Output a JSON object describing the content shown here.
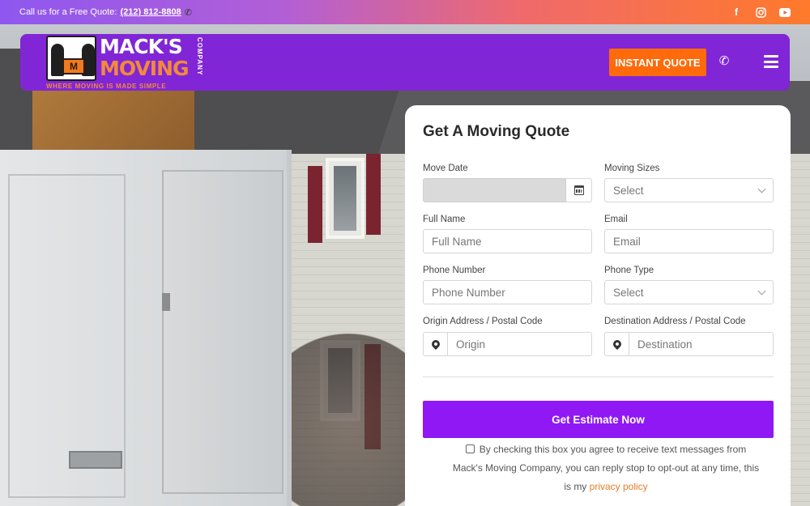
{
  "topbar": {
    "quote_prefix": "Call us for a Free Quote:",
    "phone": "(212) 812-8808",
    "social": [
      "facebook-icon",
      "instagram-icon",
      "youtube-icon"
    ]
  },
  "nav": {
    "logo": {
      "line1": "MACK'S",
      "line2": "MOVING",
      "company": "COMPANY",
      "tagline": "WHERE MOVING IS MADE SIMPLE",
      "box_letter": "M"
    },
    "instant_quote": "INSTANT QUOTE",
    "colors": {
      "nav_bg": "#8126d6",
      "accent_orange": "#ff6a0b"
    }
  },
  "form": {
    "title": "Get A Moving Quote",
    "move_date": {
      "label": "Move Date",
      "value": ""
    },
    "moving_sizes": {
      "label": "Moving Sizes",
      "value": "Select"
    },
    "full_name": {
      "label": "Full Name",
      "placeholder": "Full Name"
    },
    "email": {
      "label": "Email",
      "placeholder": "Email"
    },
    "phone_number": {
      "label": "Phone Number",
      "placeholder": "Phone Number"
    },
    "phone_type": {
      "label": "Phone Type",
      "value": "Select"
    },
    "origin": {
      "label": "Origin Address / Postal Code",
      "placeholder": "Origin"
    },
    "destination": {
      "label": "Destination Address / Postal Code",
      "placeholder": "Destination"
    },
    "submit": "Get Estimate Now",
    "consent_text": "By checking this box you agree to receive text messages from Mack's Moving Company, you can reply stop to opt-out at any time, this is my",
    "privacy_link": "privacy policy",
    "button_color": "#8f18f5"
  }
}
